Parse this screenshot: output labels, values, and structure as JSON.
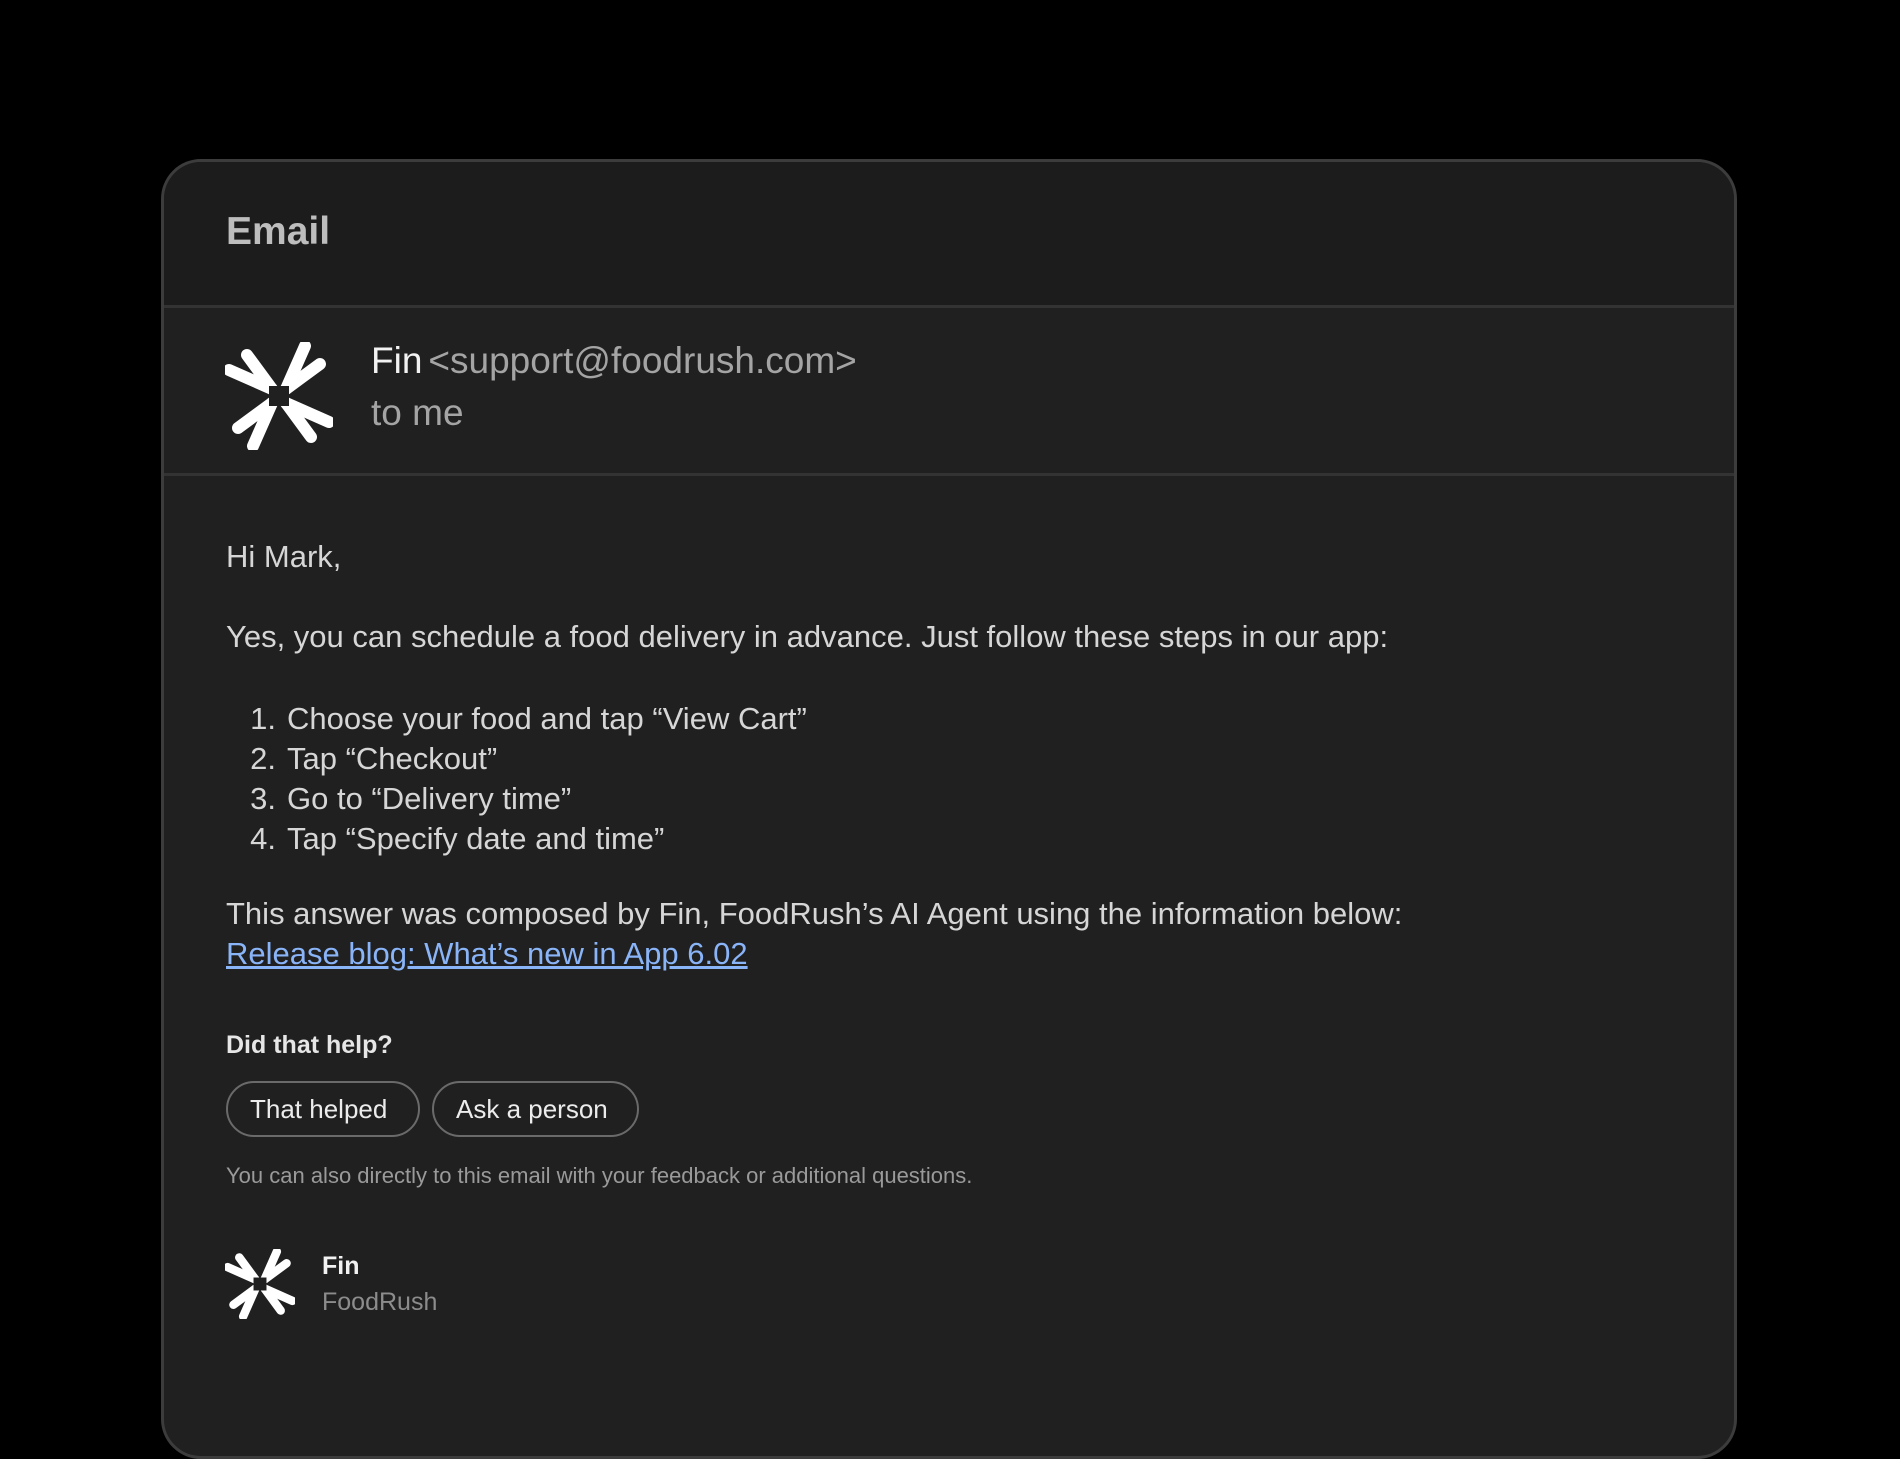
{
  "panel": {
    "title": "Email"
  },
  "sender": {
    "name": "Fin",
    "email": "<support@foodrush.com>",
    "recipient": "to me",
    "avatar_icon": "fin-logo-icon"
  },
  "message": {
    "greeting": "Hi Mark,",
    "intro": "Yes, you can schedule a food delivery in advance. Just follow these steps in our app:",
    "steps": [
      {
        "num": "1.",
        "text": "Choose your food and tap “View Cart”"
      },
      {
        "num": "2.",
        "text": "Tap “Checkout”"
      },
      {
        "num": "3.",
        "text": "Go to “Delivery time”"
      },
      {
        "num": "4.",
        "text": "Tap “Specify date and time”"
      }
    ],
    "source_note": "This answer was composed by Fin, FoodRush’s AI Agent using the information below:",
    "source_link": "Release blog: What’s new in App 6.02"
  },
  "feedback": {
    "question": "Did that help?",
    "helped_label": "That helped",
    "ask_person_label": "Ask a person",
    "footnote": "You can also directly to this email with your feedback or additional questions."
  },
  "signature": {
    "name": "Fin",
    "company": "FoodRush",
    "logo_icon": "fin-logo-icon"
  },
  "colors": {
    "background": "#000000",
    "panel": "#202020",
    "link": "#8ab4f8"
  }
}
